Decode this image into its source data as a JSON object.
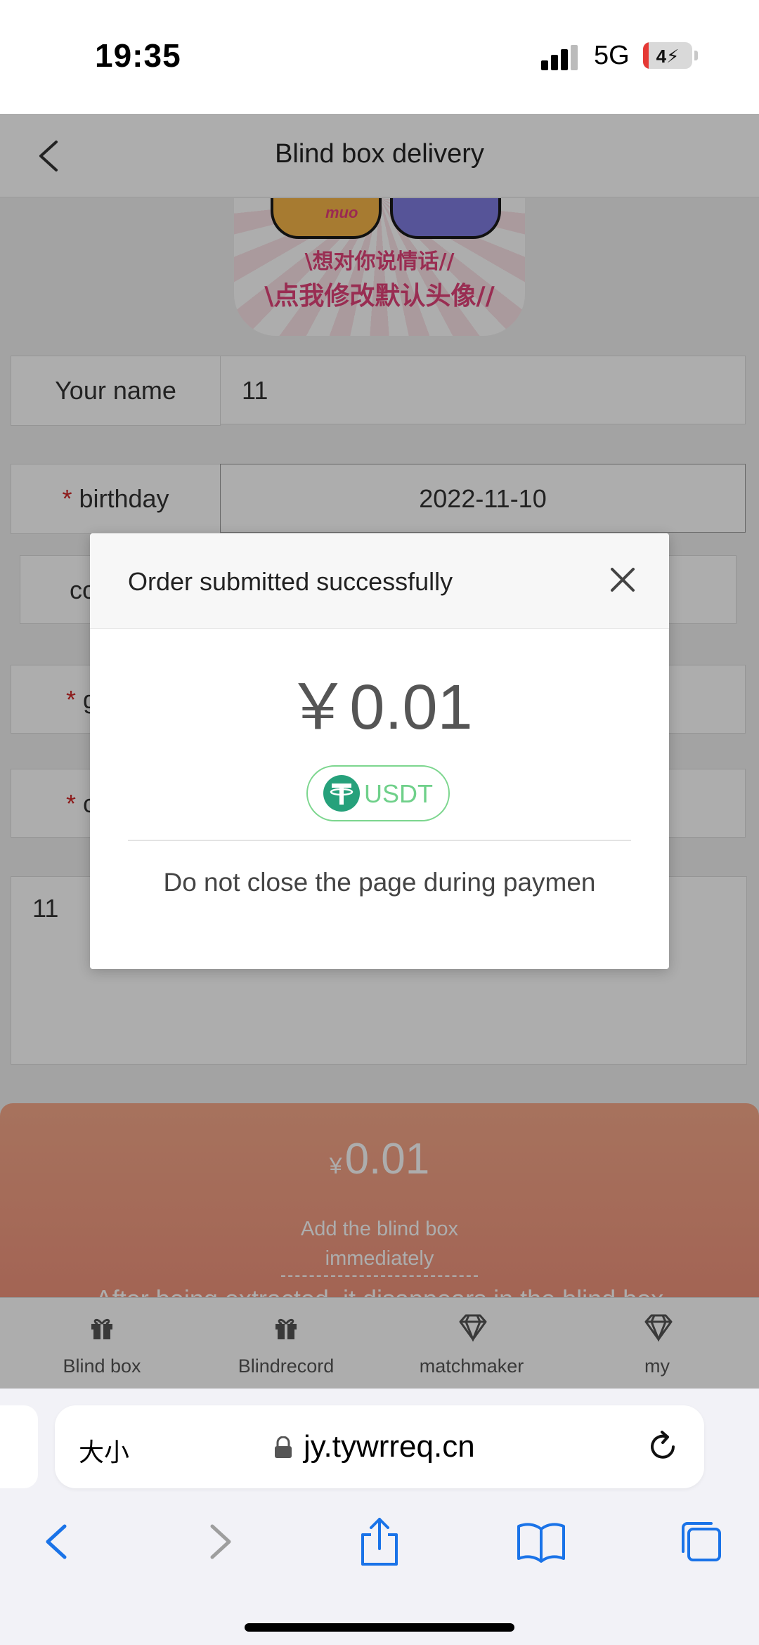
{
  "status": {
    "time": "19:35",
    "network": "5G",
    "battery": "4"
  },
  "page": {
    "title": "Blind box delivery",
    "avatar": {
      "tag": "muo",
      "line1": "\\想对你说情话//",
      "line2": "\\点我修改默认头像//"
    },
    "form": {
      "name_label": "Your name",
      "name_value": "11",
      "birthday_label": "birthday",
      "birthday_value": "2022-11-10",
      "row3_label_partial": "co",
      "row4_label_partial": "g",
      "row5_label_partial": "c",
      "required_mark": "*",
      "message_value": "11"
    },
    "panel": {
      "currency": "¥",
      "price": "0.01",
      "add_line1": "Add the blind box",
      "add_line2": "immediately",
      "note": "After being extracted, it disappears in the blind box"
    },
    "tabs": [
      {
        "label": "Blind box",
        "icon": "gift-icon"
      },
      {
        "label": "Blindrecord",
        "icon": "gift-icon"
      },
      {
        "label": "matchmaker",
        "icon": "diamond-icon"
      },
      {
        "label": "my",
        "icon": "diamond-icon"
      }
    ]
  },
  "modal": {
    "title": "Order submitted successfully",
    "price": "￥0.01",
    "method": "USDT",
    "message": "Do not close the page during paymen"
  },
  "browser": {
    "text_size": "大小",
    "url": "jy.tywrreq.cn"
  },
  "colors": {
    "accent": "#26a17b",
    "panel": "#f6a98a",
    "required": "#d02a2a"
  }
}
